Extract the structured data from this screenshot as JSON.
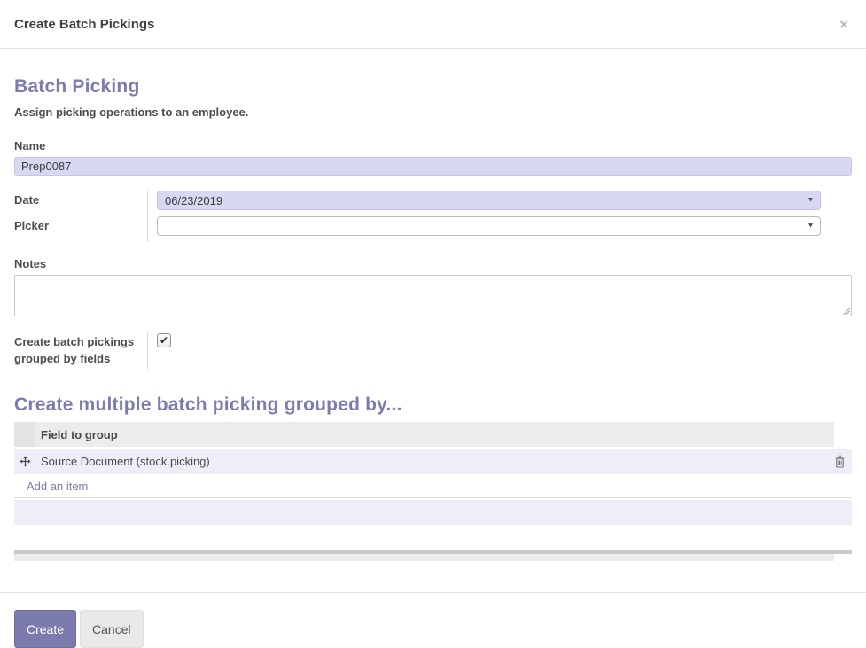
{
  "dialog": {
    "title": "Create Batch Pickings"
  },
  "icons": {
    "close": "×",
    "caret_down": "▾",
    "checkmark": "✔"
  },
  "form": {
    "heading": "Batch Picking",
    "subtitle": "Assign picking operations to an employee.",
    "name_label": "Name",
    "name_value": "Prep0087",
    "date_label": "Date",
    "date_value": "06/23/2019",
    "picker_label": "Picker",
    "picker_value": "",
    "notes_label": "Notes",
    "notes_value": "",
    "group_checkbox_label": "Create batch pickings grouped by fields",
    "group_checkbox_checked": true
  },
  "group_by_section": {
    "heading": "Create multiple batch picking grouped by...",
    "table": {
      "column_header": "Field to group",
      "rows": [
        {
          "field": "Source Document (stock.picking)"
        }
      ],
      "add_item_label": "Add an item"
    }
  },
  "footer": {
    "create_label": "Create",
    "cancel_label": "Cancel"
  },
  "colors": {
    "accent": "#7c7bad",
    "field_highlight": "#d8d8f3",
    "row_highlight": "#edeef7"
  }
}
